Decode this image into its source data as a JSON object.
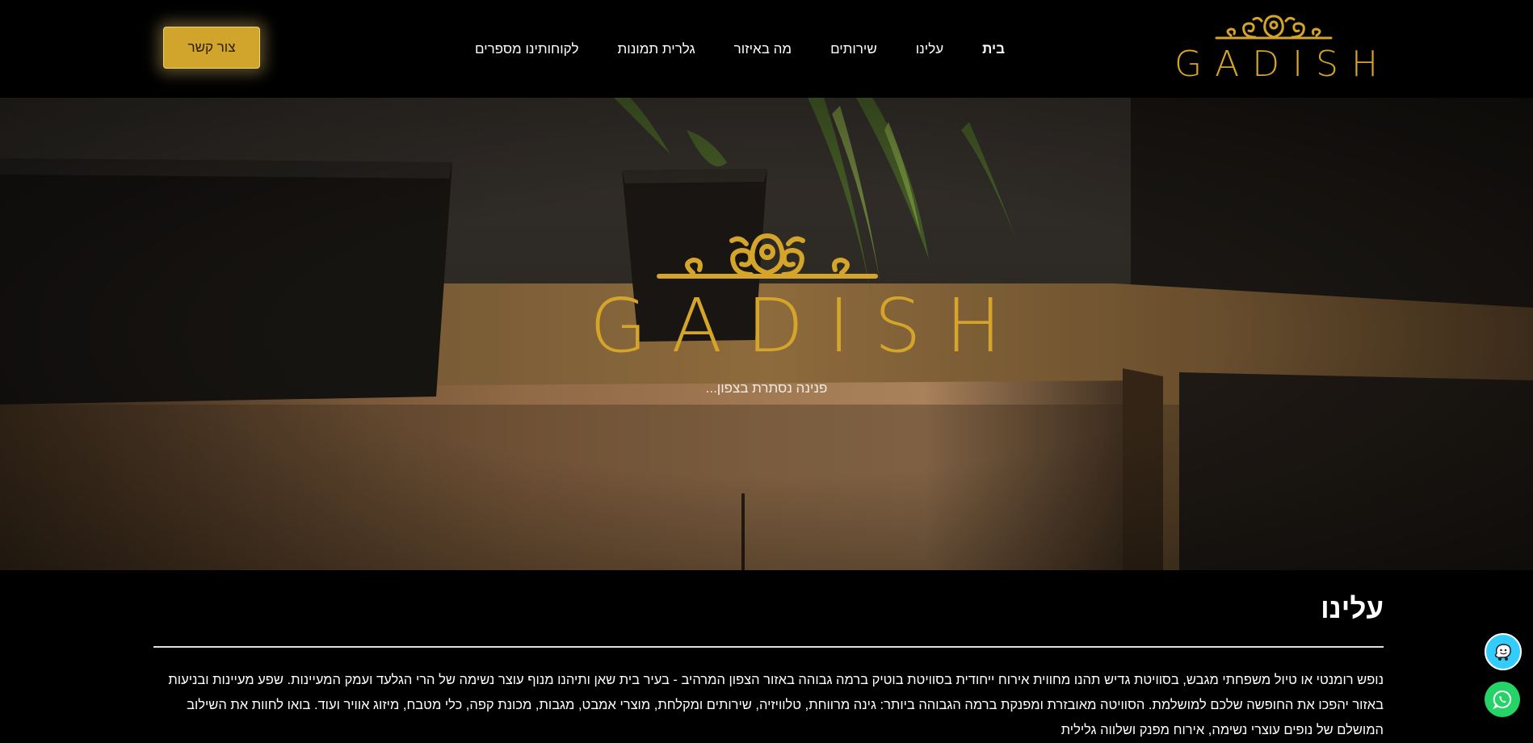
{
  "header": {
    "contact_button": "צור קשר",
    "nav": [
      {
        "label": "בית",
        "active": true
      },
      {
        "label": "עלינו",
        "active": false
      },
      {
        "label": "שירותים",
        "active": false
      },
      {
        "label": "מה באיזור",
        "active": false
      },
      {
        "label": "גלרית תמונות",
        "active": false
      },
      {
        "label": "לקוחותינו מספרים",
        "active": false
      }
    ],
    "logo_text": "GADISH"
  },
  "hero": {
    "logo_text": "GADISH",
    "tagline": "פנינה נסתרת בצפון..."
  },
  "about": {
    "title": "עלינו",
    "text": "נופש רומנטי או טיול משפחתי מגבש, בסוויטת גדיש תהנו מחווית אירוח ייחודית בסוויטת בוטיק ברמה גבוהה באזור הצפון המרהיב - בעיר בית שאן ותיהנו מנוף עוצר נשימה של הרי הגלעד ועמק המעיינות. שפע מעיינות ובניעות באזור יהפכו את החופשה שלכם למושלמת. הסוויטה מאובזרת ומפנקת ברמה הגבוהה ביותר: גינה מרווחת, טלוויזיה, שירותים ומקלחת, מוצרי אמבט, מגבות, מכונת קפה, כלי מטבח, מיזוג אוויר ועוד. בואו לחוות את השילוב המושלם של נופים עוצרי נשימה, אירוח מפנק ושלווה גלילית"
  },
  "floating": {
    "waze_icon": "waze-icon",
    "whatsapp_icon": "whatsapp-icon"
  },
  "colors": {
    "gold": "#d4a52a",
    "button_gold": "#d1a42b",
    "background": "#000000",
    "waze": "#33ccff",
    "whatsapp": "#25d366"
  }
}
